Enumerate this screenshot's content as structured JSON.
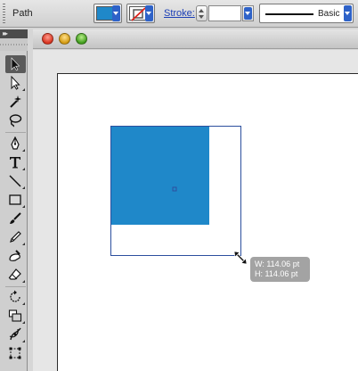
{
  "control_bar": {
    "selection_type": "Path",
    "fill_color": "#1f88c9",
    "stroke_label": "Stroke:",
    "stroke_weight": "",
    "brush_label": "Basic"
  },
  "tools": [
    "selection-tool-icon",
    "direct-selection-tool-icon",
    "magic-wand-tool-icon",
    "lasso-tool-icon",
    "pen-tool-icon",
    "type-tool-icon",
    "line-segment-tool-icon",
    "rectangle-tool-icon",
    "paintbrush-tool-icon",
    "pencil-tool-icon",
    "blob-brush-tool-icon",
    "eraser-tool-icon",
    "rotate-tool-icon",
    "scale-tool-icon",
    "puppet-warp-tool-icon",
    "free-transform-tool-icon"
  ],
  "canvas": {
    "shape_fill": "#1f88c9",
    "selection_color": "#2c4f9e",
    "tooltip": {
      "width": "W: 114.06 pt",
      "height": "H: 114.06 pt"
    }
  }
}
